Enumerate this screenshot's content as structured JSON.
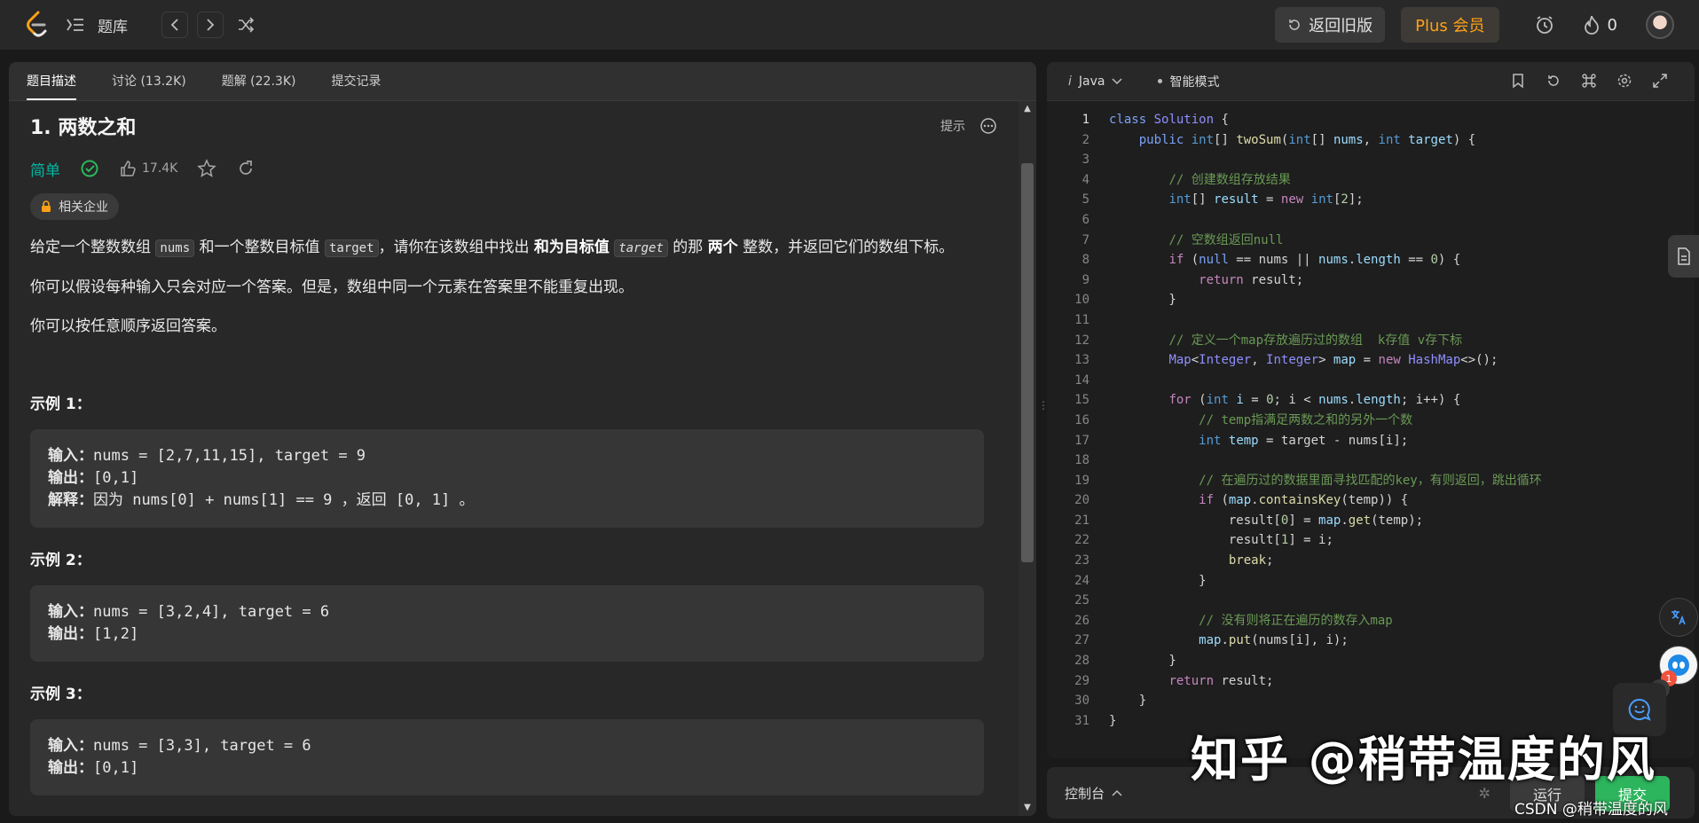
{
  "topbar": {
    "nav_label": "题库",
    "old_version_label": "返回旧版",
    "plus_label": "Plus 会员",
    "streak_count": "0"
  },
  "tabs": [
    {
      "label": "题目描述",
      "active": true
    },
    {
      "label": "讨论 (13.2K)"
    },
    {
      "label": "题解 (22.3K)"
    },
    {
      "label": "提交记录"
    }
  ],
  "problem": {
    "title": "1. 两数之和",
    "hint_label": "提示",
    "difficulty": "简单",
    "likes": "17.4K",
    "company_label": "相关企业",
    "desc": {
      "p1_a": "给定一个整数数组 ",
      "p1_code1": "nums",
      "p1_b": " 和一个整数目标值 ",
      "p1_code2": "target",
      "p1_c": "，请你在该数组中找出 ",
      "p1_bold1": "和为目标值",
      "p1_code3": "target",
      "p1_d": " 的那 ",
      "p1_bold2": "两个",
      "p1_e": " 整数，并返回它们的数组下标。",
      "p2": "你可以假设每种输入只会对应一个答案。但是，数组中同一个元素在答案里不能重复出现。",
      "p3": "你可以按任意顺序返回答案。"
    },
    "examples": [
      {
        "title": "示例 1：",
        "input_label": "输入：",
        "input": "nums = [2,7,11,15], target = 9",
        "output_label": "输出：",
        "output": "[0,1]",
        "explain_label": "解释：",
        "explain": "因为 nums[0] + nums[1] == 9 ，返回 [0, 1] 。"
      },
      {
        "title": "示例 2：",
        "input_label": "输入：",
        "input": "nums = [3,2,4], target = 6",
        "output_label": "输出：",
        "output": "[1,2]"
      },
      {
        "title": "示例 3：",
        "input_label": "输入：",
        "input": "nums = [3,3], target = 6",
        "output_label": "输出：",
        "output": "[0,1]"
      }
    ]
  },
  "editor": {
    "language": "Java",
    "mode": "智能模式",
    "lines": [
      "1",
      "2",
      "3",
      "4",
      "5",
      "6",
      "7",
      "8",
      "9",
      "10",
      "11",
      "12",
      "13",
      "14",
      "15",
      "16",
      "17",
      "18",
      "19",
      "20",
      "21",
      "22",
      "23",
      "24",
      "25",
      "26",
      "27",
      "28",
      "29",
      "30",
      "31"
    ]
  },
  "console": {
    "label": "控制台",
    "run_label": "运行",
    "submit_label": "提交"
  },
  "float": {
    "badge_count": "1"
  },
  "watermark": {
    "main": "知乎 @稍带温度的风",
    "csdn": "CSDN @稍带温度的风"
  },
  "colors": {
    "accent": "#ffa116",
    "easy": "#00b8a3",
    "submit": "#2db55d"
  }
}
